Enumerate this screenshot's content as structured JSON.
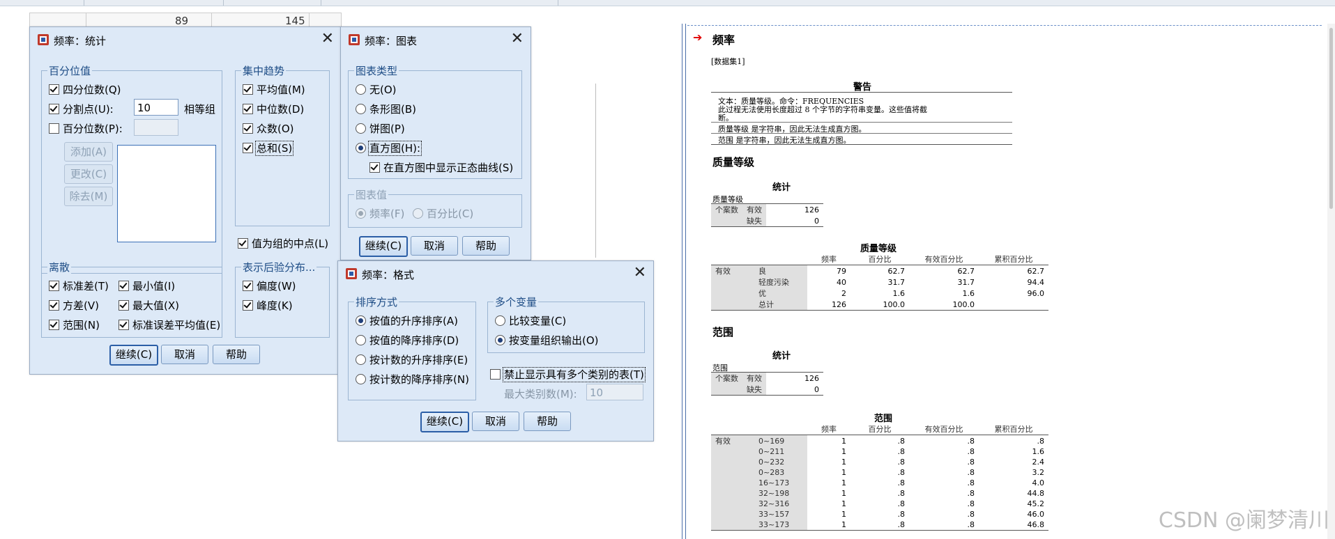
{
  "background": {
    "sheet_values": [
      "89",
      "145"
    ]
  },
  "dialog_stats": {
    "title": "频率：统计",
    "percentile_group": "百分位值",
    "quartiles": "四分位数(Q)",
    "cutpoints": "分割点(U):",
    "cutpoints_value": "10",
    "equal_groups": "相等组",
    "percentiles": "百分位数(P):",
    "add": "添加(A)",
    "change": "更改(C)",
    "remove": "除去(M)",
    "central_group": "集中趋势",
    "mean": "平均值(M)",
    "median": "中位数(D)",
    "mode": "众数(O)",
    "sum": "总和(S)",
    "midpoints": "值为组的中点(L)",
    "dispersion_group": "离散",
    "std_dev": "标准差(T)",
    "minimum": "最小值(I)",
    "variance": "方差(V)",
    "maximum": "最大值(X)",
    "range": "范围(N)",
    "se_mean": "标准误差平均值(E)",
    "distribution_group": "表示后验分布...",
    "skewness": "偏度(W)",
    "kurtosis": "峰度(K)",
    "continue": "继续(C)",
    "cancel": "取消",
    "help": "帮助"
  },
  "dialog_charts": {
    "title": "频率：图表",
    "chart_type_group": "图表类型",
    "none": "无(O)",
    "bar": "条形图(B)",
    "pie": "饼图(P)",
    "histogram": "直方图(H):",
    "normal_curve": "在直方图中显示正态曲线(S)",
    "chart_values_group": "图表值",
    "frequencies": "频率(F)",
    "percentages": "百分比(C)",
    "continue": "继续(C)",
    "cancel": "取消",
    "help": "帮助"
  },
  "dialog_format": {
    "title": "频率：格式",
    "order_group": "排序方式",
    "asc_values": "按值的升序排序(A)",
    "desc_values": "按值的降序排序(D)",
    "asc_counts": "按计数的升序排序(E)",
    "desc_counts": "按计数的降序排序(N)",
    "multi_group": "多个变量",
    "compare": "比较变量(C)",
    "organize": "按变量组织输出(O)",
    "suppress": "禁止显示具有多个类别的表(T)",
    "max_categories": "最大类别数(M):",
    "max_categories_value": "10",
    "continue": "继续(C)",
    "cancel": "取消",
    "help": "帮助"
  },
  "output": {
    "title": "频率",
    "dataset": "[数据集1]",
    "warning_title": "警告",
    "warning_line1": "文本：质量等级。命令：FREQUENCIES",
    "warning_line2": "此过程无法使用长度超过 8 个字节的字符串变量。这些值将截",
    "warning_line3": "断。",
    "warning_line4": "质量等级 是字符串，因此无法生成直方图。",
    "warning_line5": "范围 是字符串，因此无法生成直方图。",
    "sec1_title": "质量等级",
    "stats1_title": "统计",
    "stats1_var": "质量等级",
    "stats1_n": "个案数",
    "stats1_valid": "有效",
    "stats1_valid_n": "126",
    "stats1_missing": "缺失",
    "stats1_missing_n": "0",
    "freq1_title": "质量等级",
    "col_freq": "频率",
    "col_pct": "百分比",
    "col_valid_pct": "有效百分比",
    "col_cum_pct": "累积百分比",
    "valid_label": "有效",
    "freq1_rows": [
      {
        "label": "良",
        "freq": "79",
        "pct": "62.7",
        "vpct": "62.7",
        "cpct": "62.7"
      },
      {
        "label": "轻度污染",
        "freq": "40",
        "pct": "31.7",
        "vpct": "31.7",
        "cpct": "94.4"
      },
      {
        "label": "优",
        "freq": "2",
        "pct": "1.6",
        "vpct": "1.6",
        "cpct": "96.0"
      },
      {
        "label": "总计",
        "freq": "126",
        "pct": "100.0",
        "vpct": "100.0",
        "cpct": ""
      }
    ],
    "sec2_title": "范围",
    "stats2_title": "统计",
    "stats2_var": "范围",
    "stats2_n": "个案数",
    "stats2_valid": "有效",
    "stats2_valid_n": "126",
    "stats2_missing": "缺失",
    "stats2_missing_n": "0",
    "freq2_title": "范围",
    "freq2_rows": [
      {
        "label": "0~169",
        "freq": "1",
        "pct": ".8",
        "vpct": ".8",
        "cpct": ".8"
      },
      {
        "label": "0~211",
        "freq": "1",
        "pct": ".8",
        "vpct": ".8",
        "cpct": "1.6"
      },
      {
        "label": "0~232",
        "freq": "1",
        "pct": ".8",
        "vpct": ".8",
        "cpct": "2.4"
      },
      {
        "label": "0~283",
        "freq": "1",
        "pct": ".8",
        "vpct": ".8",
        "cpct": "3.2"
      },
      {
        "label": "16~173",
        "freq": "1",
        "pct": ".8",
        "vpct": ".8",
        "cpct": "4.0"
      },
      {
        "label": "32~198",
        "freq": "1",
        "pct": ".8",
        "vpct": ".8",
        "cpct": "44.8"
      },
      {
        "label": "32~316",
        "freq": "1",
        "pct": ".8",
        "vpct": ".8",
        "cpct": "45.2"
      },
      {
        "label": "33~157",
        "freq": "1",
        "pct": ".8",
        "vpct": ".8",
        "cpct": "46.0"
      },
      {
        "label": "33~173",
        "freq": "1",
        "pct": ".8",
        "vpct": ".8",
        "cpct": "46.8"
      }
    ]
  },
  "watermark": "CSDN @阑梦清川"
}
